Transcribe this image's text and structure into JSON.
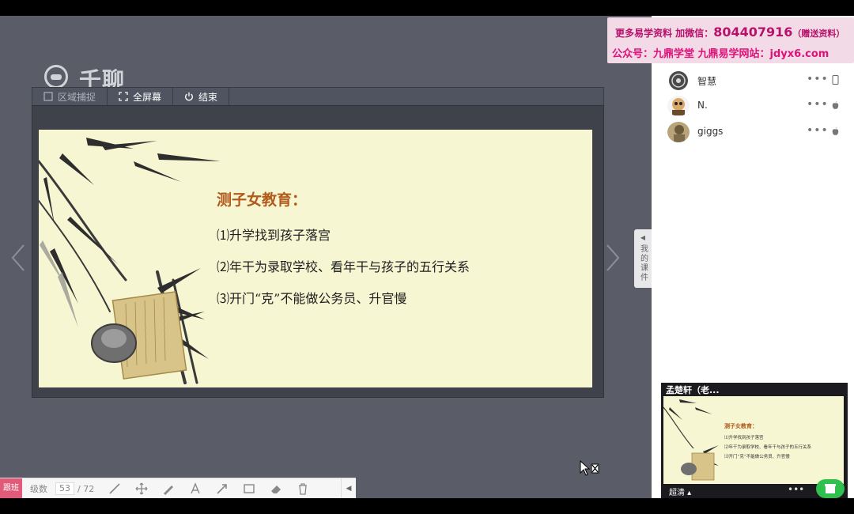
{
  "app": {
    "logo_text": "千聊"
  },
  "share_toolbar": {
    "region_label": "区域捕捉",
    "fullscreen_label": "全屏幕",
    "end_label": "结束"
  },
  "slide": {
    "title": "测子女教育：",
    "lines": [
      "⑴升学找到孩子落宫",
      "⑵年干为录取学校、看年干与孩子的五行关系",
      "⑶开门“克”不能做公务员、升官慢"
    ]
  },
  "side_tab": {
    "label": "我的课件"
  },
  "promo": {
    "line1_prefix": "更多易学资料 加微信：",
    "line1_number": "804407916",
    "line1_suffix": "（赠送资料）",
    "line2": "公众号：九鼎学堂 九鼎易学网站：jdyx6.com"
  },
  "users": [
    {
      "name": "智慧",
      "more": "•••",
      "device": "phone-icon"
    },
    {
      "name": "N.",
      "more": "•••",
      "device": "apple-icon"
    },
    {
      "name": "giggs",
      "more": "•••",
      "device": "apple-icon"
    }
  ],
  "preview": {
    "title": "孟楚轩（老...",
    "quality": "超清",
    "more": "•••"
  },
  "annotation_toolbar": {
    "tag": "跟班",
    "label": "级数",
    "current_page": "53",
    "total_pages": "/ 72"
  },
  "colors": {
    "slide_bg": "#f7f6d2",
    "slide_title": "#b25a1b",
    "promo_text": "#e0107a",
    "stage_bg": "#5a5d68"
  }
}
